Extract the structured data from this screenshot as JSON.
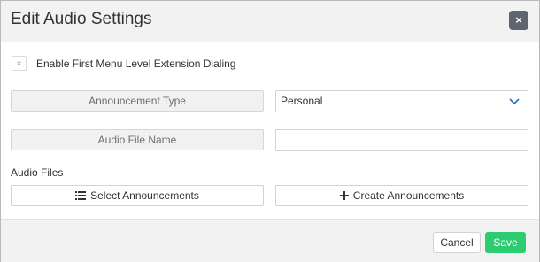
{
  "dialog": {
    "title": "Edit Audio Settings",
    "close_label": "×"
  },
  "extension_dialing": {
    "checkbox_mark": "×",
    "label": "Enable First Menu Level Extension Dialing",
    "checked": false
  },
  "announcement_type": {
    "label": "Announcement Type",
    "value": "Personal"
  },
  "audio_file_name": {
    "label": "Audio File Name",
    "value": ""
  },
  "audio_files": {
    "label": "Audio Files",
    "select_button": "Select Announcements",
    "create_button": "Create Announcements",
    "select_icon": "list-icon",
    "create_icon": "plus-icon"
  },
  "footer": {
    "cancel_label": "Cancel",
    "save_label": "Save"
  },
  "colors": {
    "save": "#2ecc71",
    "close": "#5e6470",
    "chevron": "#2a6db5"
  }
}
